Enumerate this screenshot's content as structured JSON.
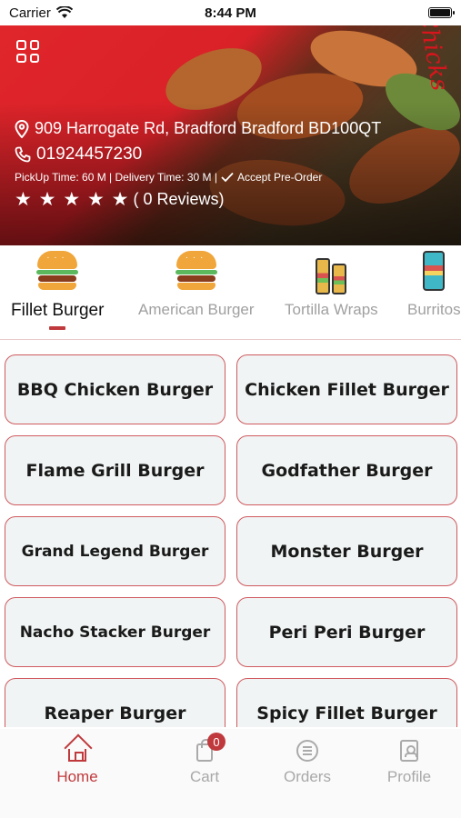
{
  "status_bar": {
    "carrier": "Carrier",
    "time": "8:44 PM"
  },
  "hero": {
    "brand_text": "ChilliChicks",
    "address": "909 Harrogate Rd, Bradford Bradford BD100QT",
    "phone": "01924457230",
    "times": "PickUp Time: 60 M | Delivery Time: 30 M |",
    "preorder": "Accept Pre-Order",
    "stars": "★ ★ ★ ★ ★",
    "reviews": "( 0 Reviews)"
  },
  "categories": [
    {
      "label": "Fillet Burger",
      "icon": "burger-icon",
      "active": true
    },
    {
      "label": "American Burger",
      "icon": "burger-icon",
      "active": false
    },
    {
      "label": "Tortilla Wraps",
      "icon": "wrap-icon",
      "active": false
    },
    {
      "label": "Burritos",
      "icon": "burrito-icon",
      "active": false
    }
  ],
  "items": [
    "BBQ Chicken Burger",
    "Chicken Fillet Burger",
    "Flame Grill Burger",
    "Godfather Burger",
    "Grand Legend Burger",
    "Monster Burger",
    "Nacho Stacker Burger",
    "Peri Peri Burger",
    "Reaper Burger",
    "Spicy Fillet Burger"
  ],
  "tab_bar": {
    "home": "Home",
    "cart": "Cart",
    "cart_count": "0",
    "orders": "Orders",
    "profile": "Profile"
  },
  "colors": {
    "accent": "#c0393c",
    "hero_red": "#e0262b",
    "item_bg": "#f1f4f4"
  }
}
